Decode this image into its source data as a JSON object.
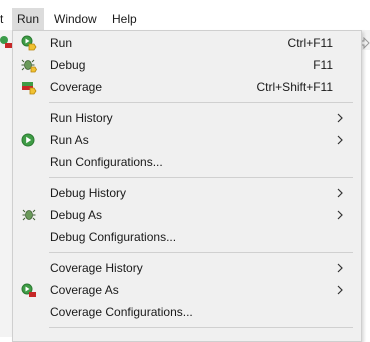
{
  "menubar": {
    "items": [
      {
        "label": "t"
      },
      {
        "label": "Run"
      },
      {
        "label": "Window"
      },
      {
        "label": "Help"
      }
    ]
  },
  "run_menu": {
    "items": [
      {
        "label": "Run",
        "accel": "Ctrl+F11",
        "icon": "run-launch-icon"
      },
      {
        "label": "Debug",
        "accel": "F11",
        "icon": "debug-bug-icon"
      },
      {
        "label": "Coverage",
        "accel": "Ctrl+Shift+F11",
        "icon": "coverage-icon"
      },
      {
        "label": "Run History",
        "submenu": true
      },
      {
        "label": "Run As",
        "submenu": true,
        "icon": "run-circle-icon"
      },
      {
        "label": "Run Configurations..."
      },
      {
        "label": "Debug History",
        "submenu": true
      },
      {
        "label": "Debug As",
        "submenu": true,
        "icon": "debug-bug-icon"
      },
      {
        "label": "Debug Configurations..."
      },
      {
        "label": "Coverage History",
        "submenu": true
      },
      {
        "label": "Coverage As",
        "submenu": true,
        "icon": "coverage-as-icon"
      },
      {
        "label": "Coverage Configurations..."
      }
    ]
  },
  "colors": {
    "menu_bg": "#f0f0f0",
    "active_menubar": "#dcdcdc",
    "run_green": "#2e9e3f",
    "separator": "#d0d0d0"
  }
}
